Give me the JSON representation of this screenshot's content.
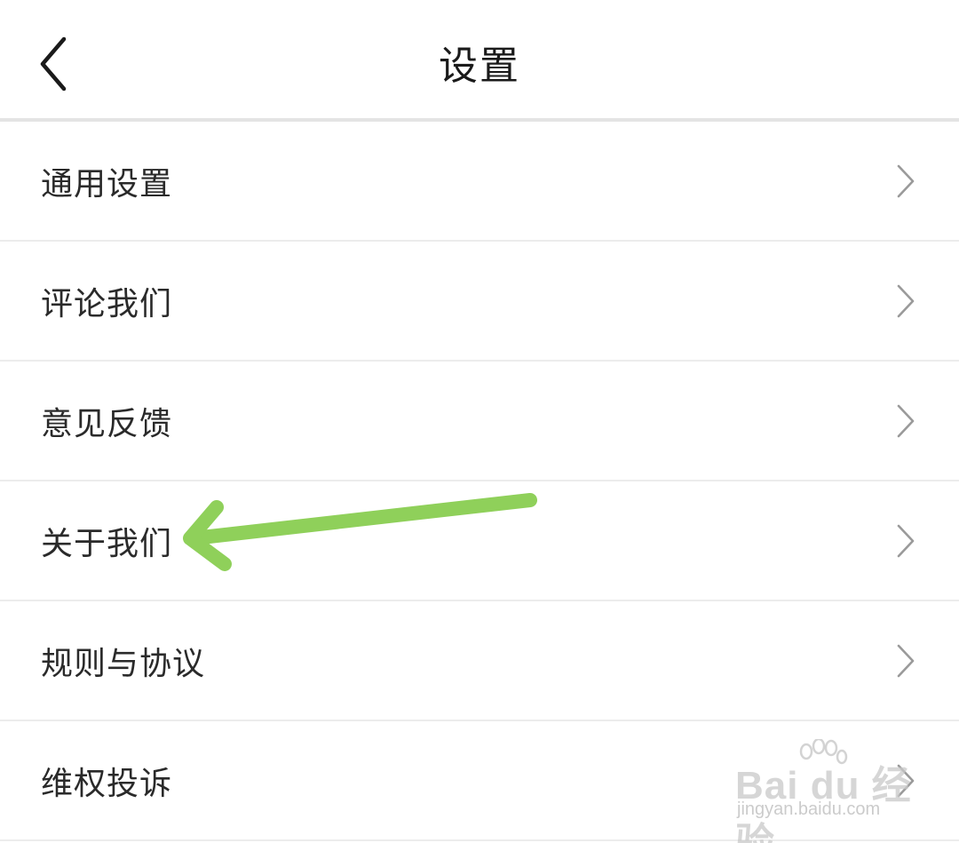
{
  "header": {
    "title": "设置",
    "back_icon": "chevron-left-icon"
  },
  "settings_list": {
    "items": [
      {
        "label": "通用设置",
        "icon": "chevron-right-icon"
      },
      {
        "label": "评论我们",
        "icon": "chevron-right-icon"
      },
      {
        "label": "意见反馈",
        "icon": "chevron-right-icon"
      },
      {
        "label": "关于我们",
        "icon": "chevron-right-icon"
      },
      {
        "label": "规则与协议",
        "icon": "chevron-right-icon"
      },
      {
        "label": "维权投诉",
        "icon": "chevron-right-icon"
      }
    ]
  },
  "annotation": {
    "type": "arrow",
    "color": "#8fd05a",
    "points_to": "关于我们"
  },
  "watermark": {
    "brand": "Bai du 经验",
    "url": "jingyan.baidu.com"
  },
  "colors": {
    "background": "#ffffff",
    "divider": "#ececec",
    "chevron": "#9a9a9a",
    "text": "#2a2a2a"
  }
}
